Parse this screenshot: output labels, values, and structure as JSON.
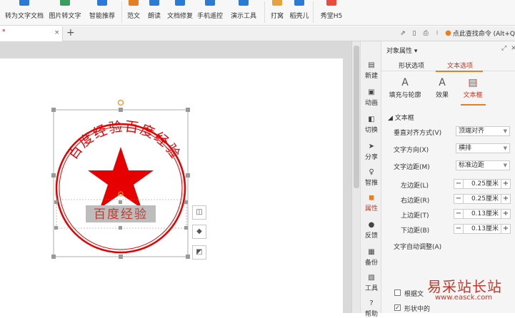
{
  "ribbon": {
    "items": [
      {
        "label": "转为文字文档",
        "icon": "convert-doc-icon",
        "color": "#2b7bd6"
      },
      {
        "label": "图片转文字",
        "icon": "image-to-text-icon",
        "color": "#3a9e5c"
      },
      {
        "label": "智能推荐",
        "icon": "smart-recommend-icon",
        "color": "#2b7bd6"
      },
      {
        "label": "范文",
        "icon": "template-icon",
        "color": "#e67e22"
      },
      {
        "label": "朗读",
        "icon": "read-aloud-icon",
        "color": "#2b7bd6"
      },
      {
        "label": "文档修复",
        "icon": "repair-icon",
        "color": "#2b7bd6"
      },
      {
        "label": "手机遥控",
        "icon": "phone-remote-icon",
        "color": "#2b7bd6"
      },
      {
        "label": "演示工具",
        "icon": "present-tools-icon",
        "color": "#2b7bd6"
      },
      {
        "label": "打窝",
        "icon": "print-icon",
        "color": "#e6a23c"
      },
      {
        "label": "稻壳儿",
        "icon": "docer-icon",
        "color": "#2b7bd6"
      },
      {
        "label": "秀堂H5",
        "icon": "h5-icon",
        "color": "#e74c3c"
      }
    ]
  },
  "tabbar": {
    "doc_marker": "*",
    "close_glyph": "×",
    "add_glyph": "+",
    "search_hint": "点此查找命令 (Alt+Q"
  },
  "sidebar": {
    "items": [
      {
        "label": "新建",
        "glyph": "▤"
      },
      {
        "label": "动画",
        "glyph": "▣"
      },
      {
        "label": "切换",
        "glyph": "◧"
      },
      {
        "label": "分享",
        "glyph": "➤"
      },
      {
        "label": "智推",
        "glyph": "♀"
      },
      {
        "label": "属性",
        "glyph": "◼"
      },
      {
        "label": "反馈",
        "glyph": "●"
      },
      {
        "label": "备份",
        "glyph": "▦"
      },
      {
        "label": "工具",
        "glyph": "▧"
      },
      {
        "label": "帮助",
        "glyph": "?"
      }
    ]
  },
  "pane": {
    "title": "对象属性 ▾",
    "tabs": [
      "形状选项",
      "文本选项"
    ],
    "subtabs": [
      {
        "label": "填充与轮廓",
        "glyph": "A"
      },
      {
        "label": "效果",
        "glyph": "A"
      },
      {
        "label": "文本框",
        "glyph": "▤"
      }
    ],
    "section": "◢ 文本框",
    "rows": [
      {
        "label": "垂直对齐方式(V)",
        "value": "顶端对齐"
      },
      {
        "label": "文字方向(X)",
        "value": "横排"
      },
      {
        "label": "文字边距(M)",
        "value": "标准边距"
      }
    ],
    "margins": [
      {
        "label": "左边距(L)",
        "value": "0.25厘米"
      },
      {
        "label": "右边距(R)",
        "value": "0.25厘米"
      },
      {
        "label": "上边距(T)",
        "value": "0.13厘米"
      },
      {
        "label": "下边距(B)",
        "value": "0.13厘米"
      }
    ],
    "autofit_label": "文字自动调整(A)",
    "check_labels": [
      "根据文",
      "形状中的"
    ]
  },
  "stamp": {
    "arc_text": "百度经验百度经验",
    "inner_text": "百度经验",
    "color": "#e60000"
  },
  "watermark": {
    "title": "易采站长站",
    "url": "www.easck.com"
  }
}
